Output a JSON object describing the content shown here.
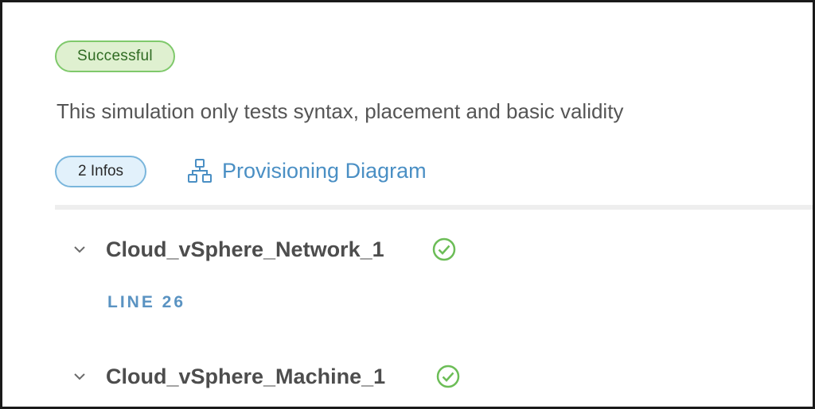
{
  "status": {
    "label": "Successful",
    "color": "#7fc96b"
  },
  "description": "This simulation only tests syntax, placement and basic validity",
  "infos_badge": "2 Infos",
  "provisioning_link": {
    "label": "Provisioning Diagram",
    "icon": "diagram-icon",
    "color": "#4a8fc4"
  },
  "resources": [
    {
      "name": "Cloud_vSphere_Network_1",
      "status_icon": "check-circle-icon",
      "expanded": true,
      "line_label": "LINE 26"
    },
    {
      "name": "Cloud_vSphere_Machine_1",
      "status_icon": "check-circle-icon",
      "expanded": true
    }
  ]
}
